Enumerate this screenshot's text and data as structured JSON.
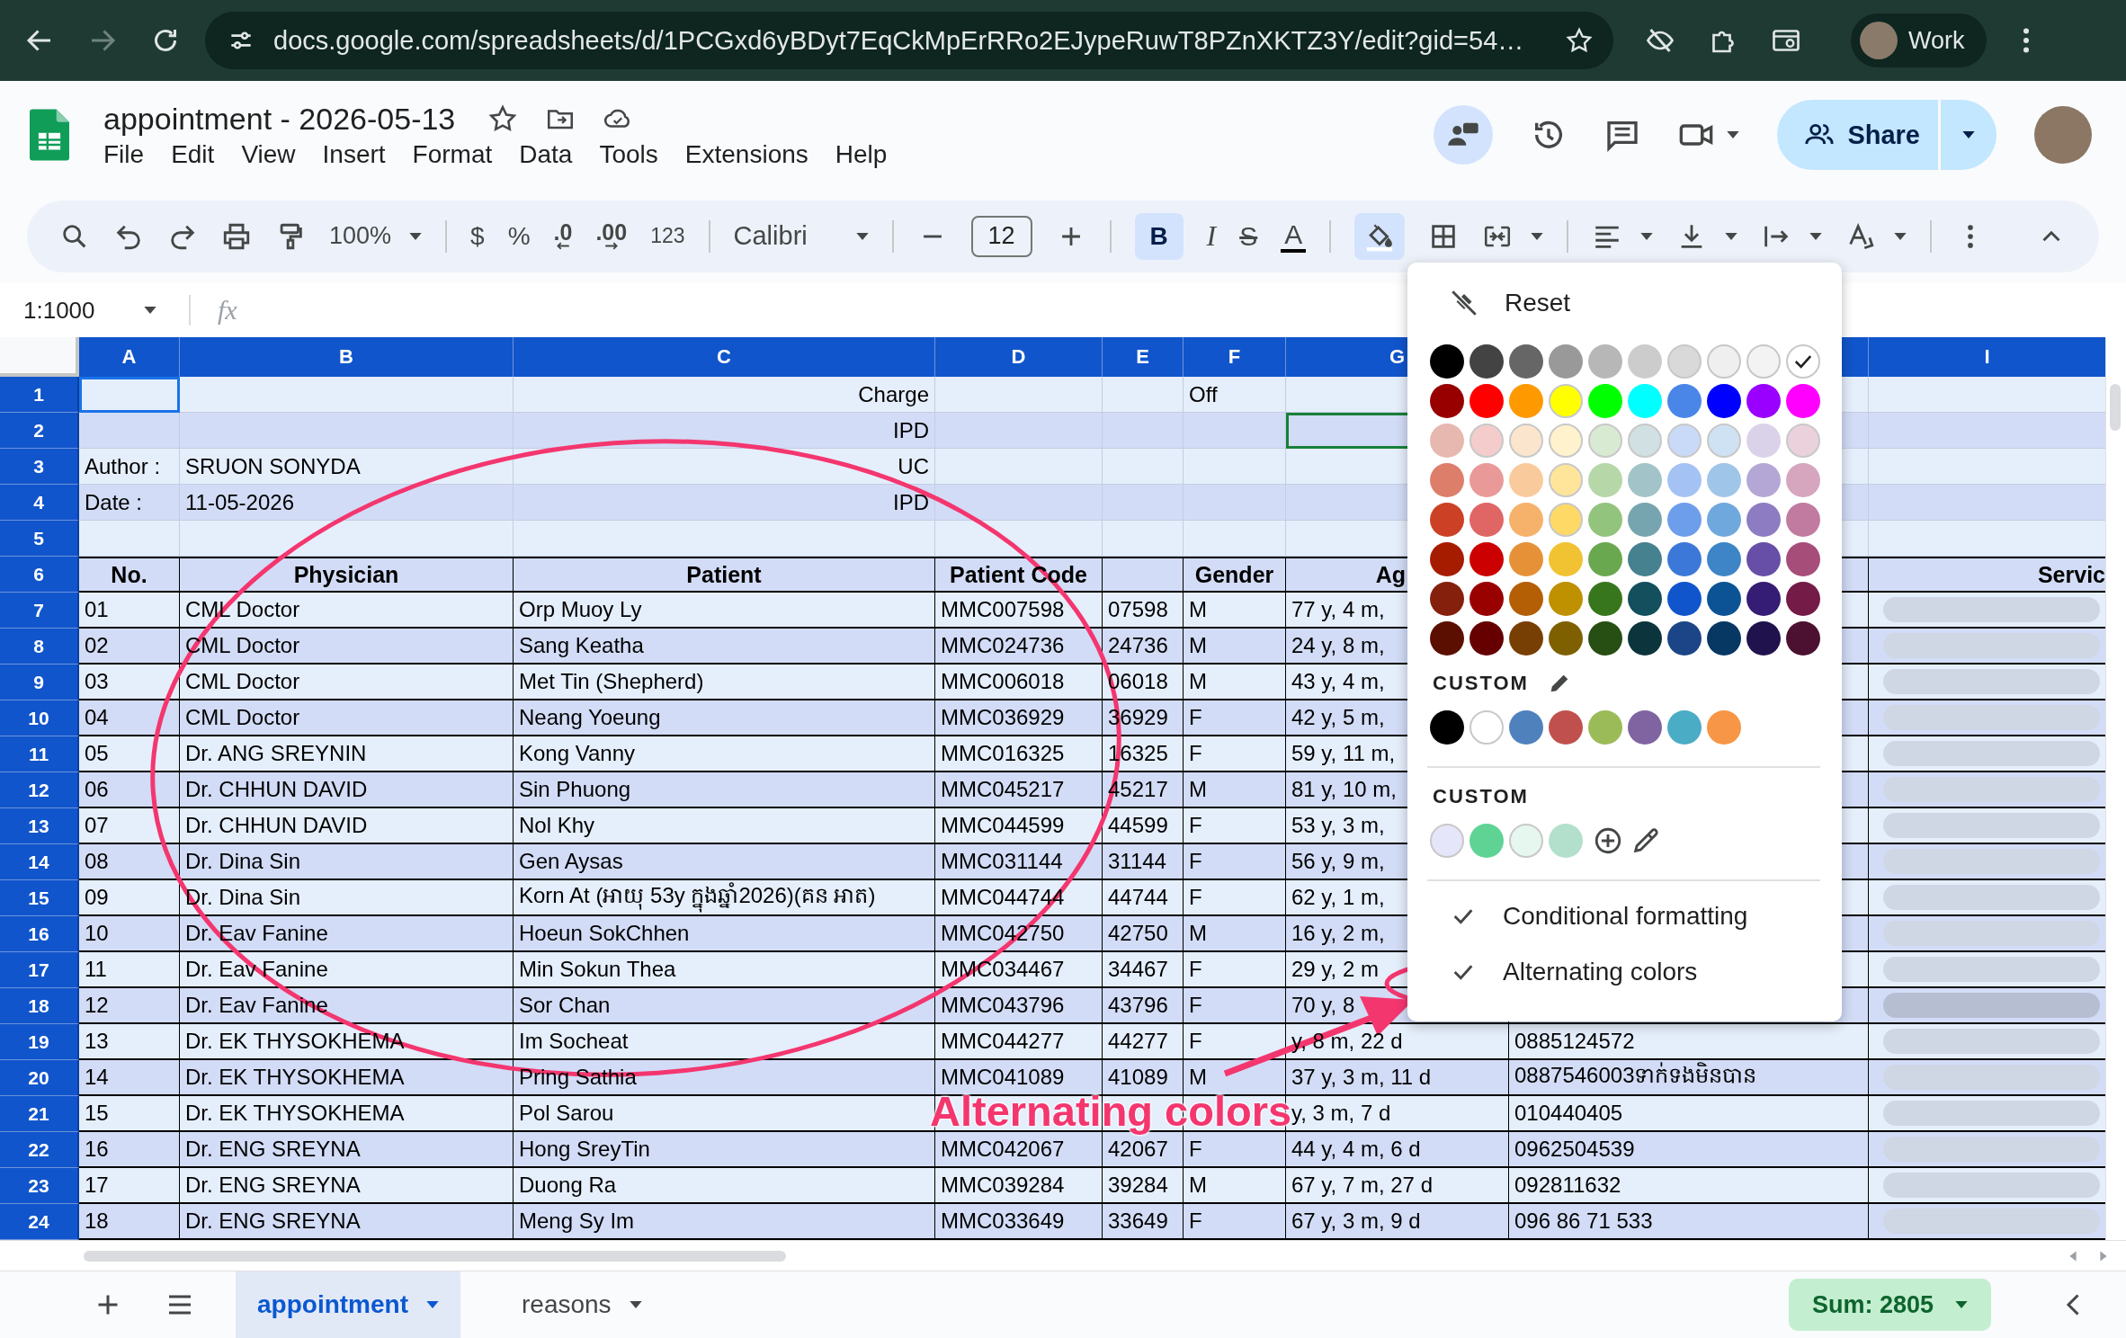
{
  "browser": {
    "url": "docs.google.com/spreadsheets/d/1PCGxd6yBDyt7EqCkMpErRRo2EJypeRuwT8PZnXKTZ3Y/edit?gid=54…",
    "profile": "Work"
  },
  "document": {
    "title": "appointment - 2026-05-13",
    "menus": [
      "File",
      "Edit",
      "View",
      "Insert",
      "Format",
      "Data",
      "Tools",
      "Extensions",
      "Help"
    ],
    "share": "Share"
  },
  "toolbar": {
    "zoom": "100%",
    "currency": "$",
    "percent": "%",
    "decrease_decimals": ".0",
    "increase_decimals": ".00",
    "number_format": "123",
    "font": "Calibri",
    "font_size": "12",
    "bold": {
      "label": "B",
      "selected": true
    },
    "italic": "I",
    "strikethrough": "S",
    "text_color": "A",
    "fill_color_selected": true
  },
  "formula_bar": {
    "name_box": "1:1000",
    "fx": "fx"
  },
  "sheet": {
    "columns": [
      "A",
      "B",
      "C",
      "D",
      "E",
      "F",
      "G",
      null,
      "I"
    ],
    "rows": [
      {
        "number": "1",
        "kind": "meta",
        "cells": [
          {
            "selected": true
          },
          null,
          "Charge",
          null,
          null,
          "Off",
          null,
          null,
          null
        ]
      },
      {
        "number": "2",
        "kind": "meta",
        "cells": [
          null,
          null,
          "IPD",
          null,
          null,
          null,
          {
            "collaborator": true
          },
          null,
          null
        ]
      },
      {
        "number": "3",
        "kind": "meta",
        "cells": [
          "Author :",
          "SRUON SONYDA",
          "UC",
          null,
          null,
          null,
          null,
          null,
          null
        ]
      },
      {
        "number": "4",
        "kind": "meta",
        "cells": [
          "Date :",
          "11-05-2026",
          "IPD",
          null,
          null,
          null,
          null,
          null,
          null
        ]
      },
      {
        "number": "5",
        "kind": "meta",
        "cells": [
          null,
          null,
          null,
          null,
          null,
          null,
          null,
          null,
          null
        ]
      },
      {
        "number": "6",
        "kind": "header",
        "cells": [
          "No.",
          "Physician",
          "Patient",
          "Patient Code",
          null,
          "Gender",
          "Ag",
          null,
          "Servic"
        ]
      },
      {
        "number": "7",
        "kind": "data",
        "chip_hovered": false,
        "cells": [
          "01",
          "CML Doctor",
          "Orp Muoy Ly",
          "MMC007598",
          "07598",
          "M",
          "77 y, 4 m,",
          null,
          null
        ]
      },
      {
        "number": "8",
        "kind": "data",
        "chip_hovered": false,
        "cells": [
          "02",
          "CML Doctor",
          "Sang Keatha",
          "MMC024736",
          "24736",
          "M",
          "24 y, 8 m,",
          null,
          null
        ]
      },
      {
        "number": "9",
        "kind": "data",
        "chip_hovered": false,
        "cells": [
          "03",
          "CML Doctor",
          "Met Tin (Shepherd)",
          "MMC006018",
          "06018",
          "M",
          "43 y, 4 m,",
          null,
          null
        ]
      },
      {
        "number": "10",
        "kind": "data",
        "chip_hovered": false,
        "cells": [
          "04",
          "CML Doctor",
          "Neang Yoeung",
          "MMC036929",
          "36929",
          "F",
          "42 y, 5 m,",
          null,
          null
        ]
      },
      {
        "number": "11",
        "kind": "data",
        "chip_hovered": false,
        "cells": [
          "05",
          "Dr. ANG SREYNIN",
          "Kong Vanny",
          "MMC016325",
          "16325",
          "F",
          "59 y, 11 m,",
          null,
          null
        ]
      },
      {
        "number": "12",
        "kind": "data",
        "chip_hovered": false,
        "cells": [
          "06",
          "Dr. CHHUN DAVID",
          "Sin Phuong",
          "MMC045217",
          "45217",
          "M",
          "81 y, 10 m,",
          null,
          null
        ]
      },
      {
        "number": "13",
        "kind": "data",
        "chip_hovered": false,
        "cells": [
          "07",
          "Dr. CHHUN DAVID",
          "Nol Khy",
          "MMC044599",
          "44599",
          "F",
          "53 y, 3 m,",
          null,
          null
        ]
      },
      {
        "number": "14",
        "kind": "data",
        "chip_hovered": false,
        "cells": [
          "08",
          "Dr. Dina Sin",
          "Gen Aysas",
          "MMC031144",
          "31144",
          "F",
          "56 y, 9 m,",
          null,
          null
        ]
      },
      {
        "number": "15",
        "kind": "data",
        "chip_hovered": false,
        "cells": [
          "09",
          "Dr. Dina Sin",
          "Korn At (អាយុ 53y ក្នុងឆ្នាំ2026)(គន អាត)",
          "MMC044744",
          "44744",
          "F",
          "62 y, 1 m,",
          null,
          null
        ]
      },
      {
        "number": "16",
        "kind": "data",
        "chip_hovered": false,
        "cells": [
          "10",
          "Dr. Eav Fanine",
          "Hoeun SokChhen",
          "MMC042750",
          "42750",
          "M",
          "16 y, 2 m,",
          null,
          null
        ]
      },
      {
        "number": "17",
        "kind": "data",
        "chip_hovered": false,
        "cells": [
          "11",
          "Dr. Eav Fanine",
          "Min Sokun Thea",
          "MMC034467",
          "34467",
          "F",
          "29 y, 2 m",
          null,
          null
        ]
      },
      {
        "number": "18",
        "kind": "data",
        "chip_hovered": true,
        "cells": [
          "12",
          "Dr. Eav Fanine",
          "Sor Chan",
          "MMC043796",
          "43796",
          "F",
          "70 y, 8",
          null,
          null
        ]
      },
      {
        "number": "19",
        "kind": "data",
        "chip_hovered": false,
        "cells": [
          "13",
          "Dr. EK THYSOKHEMA",
          "Im Socheat",
          "MMC044277",
          "44277",
          "F",
          "y, 8 m, 22 d",
          "0885124572",
          null
        ]
      },
      {
        "number": "20",
        "kind": "data",
        "chip_hovered": false,
        "cells": [
          "14",
          "Dr. EK THYSOKHEMA",
          "Pring Sathia",
          "MMC041089",
          "41089",
          "M",
          "37 y, 3 m, 11 d",
          "0887546003ទាក់ទងមិនបាន",
          null
        ]
      },
      {
        "number": "21",
        "kind": "data",
        "chip_hovered": false,
        "cells": [
          "15",
          "Dr. EK THYSOKHEMA",
          "Pol Sarou",
          null,
          null,
          null,
          "y, 3 m, 7 d",
          "010440405",
          null
        ]
      },
      {
        "number": "22",
        "kind": "data",
        "chip_hovered": false,
        "cells": [
          "16",
          "Dr. ENG SREYNA",
          "Hong SreyTin",
          "MMC042067",
          "42067",
          "F",
          "44 y, 4 m, 6 d",
          "0962504539",
          null
        ]
      },
      {
        "number": "23",
        "kind": "data",
        "chip_hovered": false,
        "cells": [
          "17",
          "Dr. ENG SREYNA",
          "Duong Ra",
          "MMC039284",
          "39284",
          "M",
          "67 y, 7 m, 27 d",
          "092811632",
          null
        ]
      },
      {
        "number": "24",
        "kind": "data",
        "chip_hovered": false,
        "cells": [
          "18",
          "Dr. ENG SREYNA",
          "Meng Sy Im",
          "MMC033649",
          "33649",
          "F",
          "67 y, 3 m, 9 d",
          "096 86 71 533",
          null
        ]
      }
    ]
  },
  "fill_menu": {
    "reset": "Reset",
    "palette": [
      [
        {
          "color": "#000000",
          "selected": false
        },
        {
          "color": "#434343",
          "selected": false
        },
        {
          "color": "#666666",
          "selected": false
        },
        {
          "color": "#999999",
          "selected": false
        },
        {
          "color": "#b7b7b7",
          "selected": false
        },
        {
          "color": "#cccccc",
          "selected": false
        },
        {
          "color": "#d9d9d9",
          "selected": false
        },
        {
          "color": "#efefef",
          "selected": false
        },
        {
          "color": "#f3f3f3",
          "selected": false
        },
        {
          "color": "#ffffff",
          "selected": true
        }
      ],
      [
        {
          "color": "#980000",
          "selected": false
        },
        {
          "color": "#ff0000",
          "selected": false
        },
        {
          "color": "#ff9900",
          "selected": false
        },
        {
          "color": "#ffff00",
          "selected": false
        },
        {
          "color": "#00ff00",
          "selected": false
        },
        {
          "color": "#00ffff",
          "selected": false
        },
        {
          "color": "#4a86e8",
          "selected": false
        },
        {
          "color": "#0000ff",
          "selected": false
        },
        {
          "color": "#9900ff",
          "selected": false
        },
        {
          "color": "#ff00ff",
          "selected": false
        }
      ],
      [
        {
          "color": "#e6b8af",
          "selected": false
        },
        {
          "color": "#f4cccc",
          "selected": false
        },
        {
          "color": "#fce5cd",
          "selected": false
        },
        {
          "color": "#fff2cc",
          "selected": false
        },
        {
          "color": "#d9ead3",
          "selected": false
        },
        {
          "color": "#d0e0e3",
          "selected": false
        },
        {
          "color": "#c9daf8",
          "selected": false
        },
        {
          "color": "#cfe2f3",
          "selected": false
        },
        {
          "color": "#d9d2e9",
          "selected": false
        },
        {
          "color": "#ead1dc",
          "selected": false
        }
      ],
      [
        {
          "color": "#dd7e6b",
          "selected": false
        },
        {
          "color": "#ea9999",
          "selected": false
        },
        {
          "color": "#f9cb9c",
          "selected": false
        },
        {
          "color": "#ffe599",
          "selected": false
        },
        {
          "color": "#b6d7a8",
          "selected": false
        },
        {
          "color": "#a2c4c9",
          "selected": false
        },
        {
          "color": "#a4c2f4",
          "selected": false
        },
        {
          "color": "#9fc5e8",
          "selected": false
        },
        {
          "color": "#b4a7d6",
          "selected": false
        },
        {
          "color": "#d5a6bd",
          "selected": false
        }
      ],
      [
        {
          "color": "#cc4125",
          "selected": false
        },
        {
          "color": "#e06666",
          "selected": false
        },
        {
          "color": "#f6b26b",
          "selected": false
        },
        {
          "color": "#ffd966",
          "selected": false
        },
        {
          "color": "#93c47d",
          "selected": false
        },
        {
          "color": "#76a5af",
          "selected": false
        },
        {
          "color": "#6d9eeb",
          "selected": false
        },
        {
          "color": "#6fa8dc",
          "selected": false
        },
        {
          "color": "#8e7cc3",
          "selected": false
        },
        {
          "color": "#c27ba0",
          "selected": false
        }
      ],
      [
        {
          "color": "#a61c00",
          "selected": false
        },
        {
          "color": "#cc0000",
          "selected": false
        },
        {
          "color": "#e69138",
          "selected": false
        },
        {
          "color": "#f1c232",
          "selected": false
        },
        {
          "color": "#6aa84f",
          "selected": false
        },
        {
          "color": "#45818e",
          "selected": false
        },
        {
          "color": "#3c78d8",
          "selected": false
        },
        {
          "color": "#3d85c6",
          "selected": false
        },
        {
          "color": "#674ea7",
          "selected": false
        },
        {
          "color": "#a64d79",
          "selected": false
        }
      ],
      [
        {
          "color": "#85200c",
          "selected": false
        },
        {
          "color": "#990000",
          "selected": false
        },
        {
          "color": "#b45f06",
          "selected": false
        },
        {
          "color": "#bf9000",
          "selected": false
        },
        {
          "color": "#38761d",
          "selected": false
        },
        {
          "color": "#134f5c",
          "selected": false
        },
        {
          "color": "#1155cc",
          "selected": false
        },
        {
          "color": "#0b5394",
          "selected": false
        },
        {
          "color": "#351c75",
          "selected": false
        },
        {
          "color": "#741b47",
          "selected": false
        }
      ],
      [
        {
          "color": "#5b0f00",
          "selected": false
        },
        {
          "color": "#660000",
          "selected": false
        },
        {
          "color": "#783f04",
          "selected": false
        },
        {
          "color": "#7f6000",
          "selected": false
        },
        {
          "color": "#274e13",
          "selected": false
        },
        {
          "color": "#0c343d",
          "selected": false
        },
        {
          "color": "#1c4587",
          "selected": false
        },
        {
          "color": "#073763",
          "selected": false
        },
        {
          "color": "#20124d",
          "selected": false
        },
        {
          "color": "#4c1130",
          "selected": false
        }
      ]
    ],
    "custom_label": "CUSTOM",
    "custom_colors": [
      {
        "color": "#000000",
        "selected": false
      },
      {
        "color": "#ffffff",
        "selected": false
      },
      {
        "color": "#4f81bd",
        "selected": false
      },
      {
        "color": "#c0504d",
        "selected": false
      },
      {
        "color": "#9bbb59",
        "selected": false
      },
      {
        "color": "#8064a2",
        "selected": false
      },
      {
        "color": "#4bacc6",
        "selected": false
      },
      {
        "color": "#f79646",
        "selected": false
      }
    ],
    "custom_label_2": "CUSTOM",
    "custom_colors_2": [
      {
        "color": "#e6e6fa",
        "selected": false
      },
      {
        "color": "#5fd394",
        "selected": false
      },
      {
        "color": "#e6f7ef",
        "selected": false
      },
      {
        "color": "#b3e0cc",
        "selected": false
      }
    ],
    "items": [
      {
        "label": "Conditional formatting",
        "checked": true
      },
      {
        "label": "Alternating colors",
        "checked": true
      }
    ]
  },
  "sheet_tabs": [
    {
      "label": "appointment",
      "selected": true
    },
    {
      "label": "reasons",
      "selected": false
    }
  ],
  "sum": "Sum: 2805",
  "annotation": {
    "text": "Alternating colors"
  }
}
